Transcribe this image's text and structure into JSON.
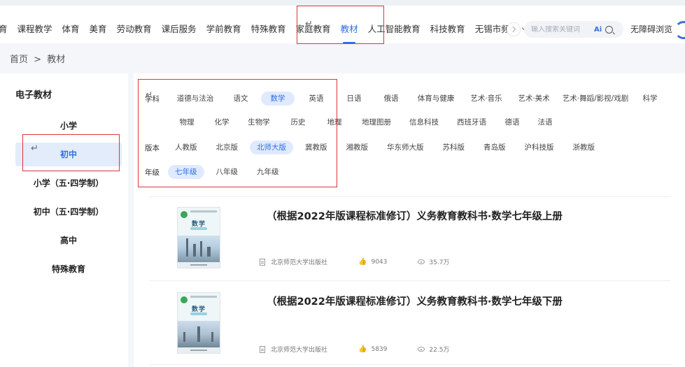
{
  "nav": {
    "items": [
      "育",
      "课程教学",
      "体育",
      "美育",
      "劳动教育",
      "课后服务",
      "学前教育",
      "特殊教育",
      "家庭教育",
      "教材",
      "人工智能教育",
      "科技教育"
    ],
    "active_index": 9,
    "more_label": "无锡市频道",
    "search_placeholder": "输入搜索关键词",
    "ai_label": "Ai",
    "accessibility_label": "无障碍浏览"
  },
  "breadcrumb": {
    "home": "首页",
    "separator": ">",
    "current": "教材"
  },
  "sidebar": {
    "title": "电子教材",
    "items": [
      "小学",
      "初中",
      "小学（五·四学制）",
      "初中（五·四学制）",
      "高中",
      "特殊教育"
    ],
    "active_index": 1
  },
  "filters": {
    "subject": {
      "label": "学科",
      "row1": [
        "道德与法治",
        "语文",
        "数学",
        "英语",
        "日语",
        "俄语",
        "体育与健康",
        "艺术·音乐",
        "艺术·美术",
        "艺术·舞蹈/影视/戏剧",
        "科学"
      ],
      "row2": [
        "物理",
        "化学",
        "生物学",
        "历史",
        "地理",
        "地理图册",
        "信息科技",
        "西班牙语",
        "德语",
        "法语"
      ],
      "selected": "数学"
    },
    "edition": {
      "label": "版本",
      "options": [
        "人教版",
        "北京版",
        "北师大版",
        "冀教版",
        "湘教版",
        "华东师大版",
        "苏科版",
        "青岛版",
        "沪科技版",
        "浙教版"
      ],
      "selected": "北师大版"
    },
    "grade": {
      "label": "年级",
      "options": [
        "七年级",
        "八年级",
        "九年级"
      ],
      "selected": "七年级"
    }
  },
  "books": [
    {
      "title": "（根据2022年版课程标准修订）义务教育教科书·数学七年级上册",
      "cover_title": "数学",
      "publisher": "北京师范大学出版社",
      "likes": "9043",
      "views": "35.7万"
    },
    {
      "title": "（根据2022年版课程标准修订）义务教育教科书·数学七年级下册",
      "cover_title": "数学",
      "publisher": "北京师范大学出版社",
      "likes": "5839",
      "views": "22.5万"
    }
  ],
  "colors": {
    "accent": "#2f6fe0",
    "selected_bg": "#e0eaff",
    "highlight_border": "#d9363e"
  }
}
